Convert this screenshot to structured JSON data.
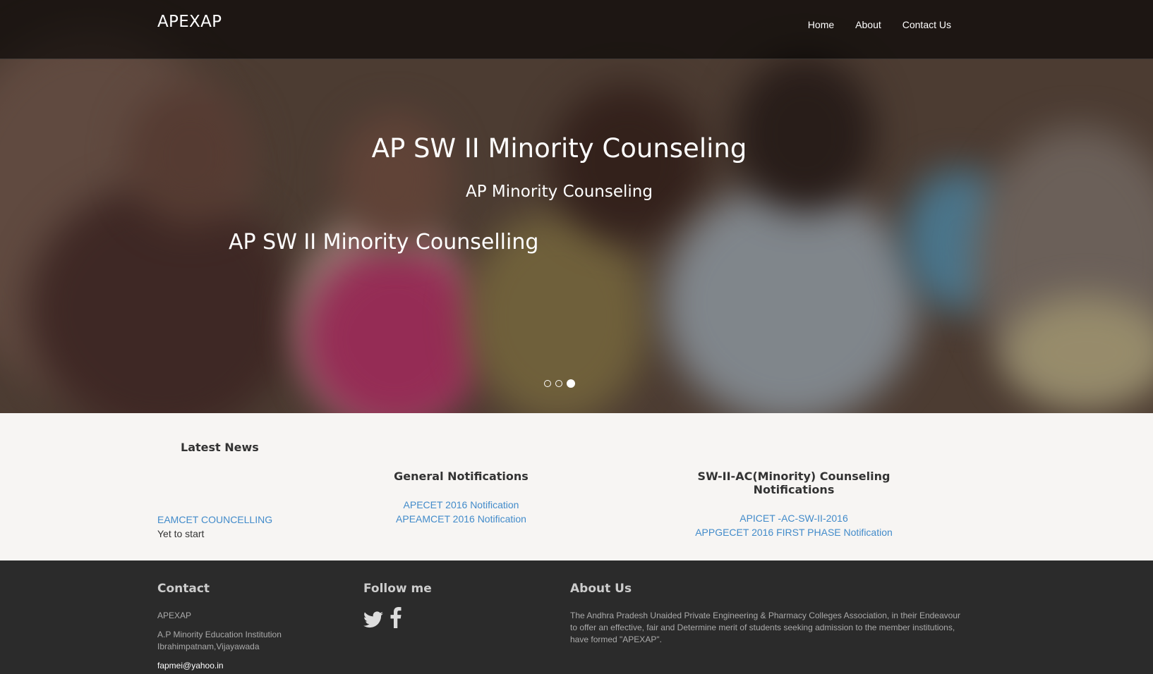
{
  "header": {
    "brand": "APEXAP",
    "nav": [
      "Home",
      "About",
      "Contact Us"
    ]
  },
  "hero": {
    "title": "AP SW II Minority Counseling",
    "subtitle": "AP Minority Counseling",
    "caption": "AP SW II Minority Counselling",
    "slides": 3,
    "active_slide": 3
  },
  "news": {
    "latest": {
      "title": "Latest News",
      "link": "EAMCET COUNCELLING",
      "status": "Yet to start"
    },
    "general": {
      "title": "General Notifications",
      "links": [
        "APECET 2016 Notification",
        "APEAMCET 2016 Notification"
      ]
    },
    "minority": {
      "title": "SW-II-AC(Minority) Counseling Notifications",
      "links": [
        "APICET -AC-SW-II-2016",
        "APPGECET 2016 FIRST PHASE Notification"
      ]
    }
  },
  "footer": {
    "contact": {
      "title": "Contact",
      "name": "APEXAP",
      "address_line1": "A.P Minority Education Institution",
      "address_line2": "Ibrahimpatnam,Vijayawada",
      "email": "fapmei@yahoo.in"
    },
    "follow": {
      "title": "Follow me",
      "icons": [
        "twitter-icon",
        "facebook-icon"
      ]
    },
    "about": {
      "title": "About Us",
      "text": "The Andhra Pradesh Unaided Private Engineering & Pharmacy Colleges Association, in their Endeavour to offer an effective, fair and Determine merit of students seeking admission to the member institutions, have formed \"APEXAP\"."
    }
  },
  "colors": {
    "link": "#428bca",
    "footer_bg": "#2b2b2b",
    "news_bg": "#f7f5f3"
  }
}
